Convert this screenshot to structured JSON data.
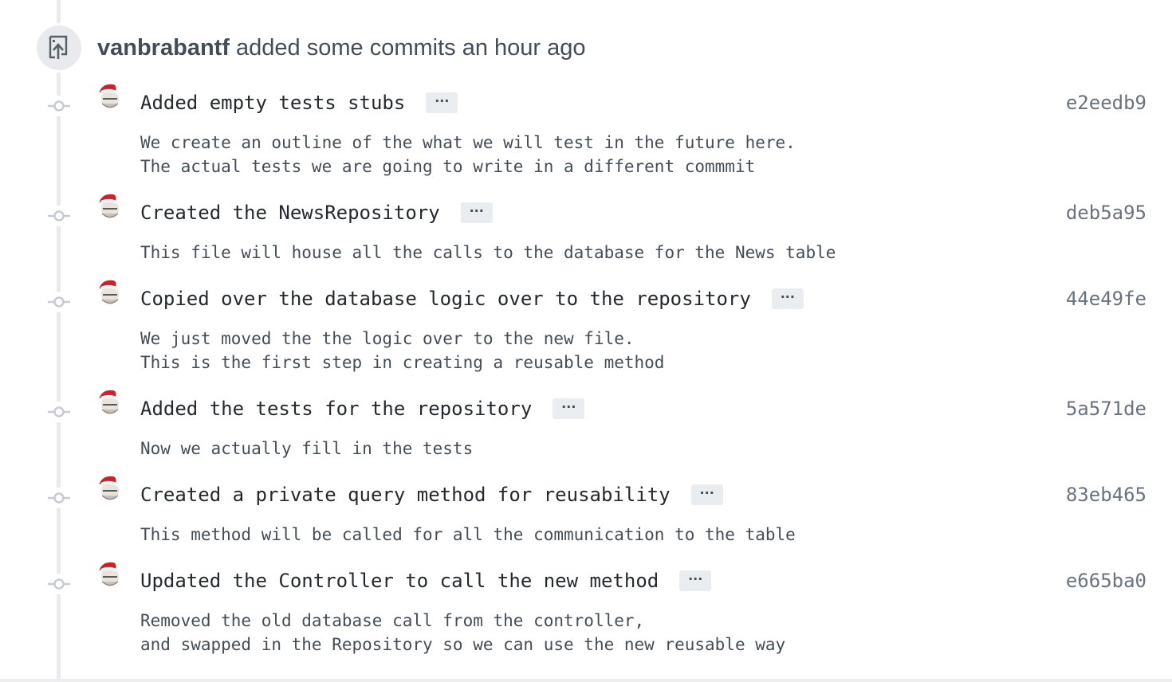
{
  "event": {
    "author": "vanbrabantf",
    "action": "added some commits",
    "time": "an hour ago",
    "icon": "repo-push-icon"
  },
  "commits": [
    {
      "message": "Added empty tests stubs",
      "ellipsis": "···",
      "sha": "e2eedb9",
      "body": "We create an outline of the what we will test in the future here.\nThe actual tests we are going to write in a different commmit"
    },
    {
      "message": "Created the NewsRepository",
      "ellipsis": "···",
      "sha": "deb5a95",
      "body": "This file will house all the calls to the database for the News table"
    },
    {
      "message": "Copied over the database logic over to the repository",
      "ellipsis": "···",
      "sha": "44e49fe",
      "body": "We just moved the the logic over to the new file.\nThis is the first step in creating a reusable method"
    },
    {
      "message": "Added the tests for the repository",
      "ellipsis": "···",
      "sha": "5a571de",
      "body": "Now we actually fill in the tests"
    },
    {
      "message": "Created a private query method for reusability",
      "ellipsis": "···",
      "sha": "83eb465",
      "body": "This method will be called for all the communication to the table"
    },
    {
      "message": "Updated the Controller to call the new method",
      "ellipsis": "···",
      "sha": "e665ba0",
      "body": "Removed the old database call from the controller,\nand swapped in the Repository so we can use the new reusable way"
    }
  ],
  "colors": {
    "timeline": "#e8eaed",
    "sha": "#6a737d",
    "text": "#24292e"
  }
}
